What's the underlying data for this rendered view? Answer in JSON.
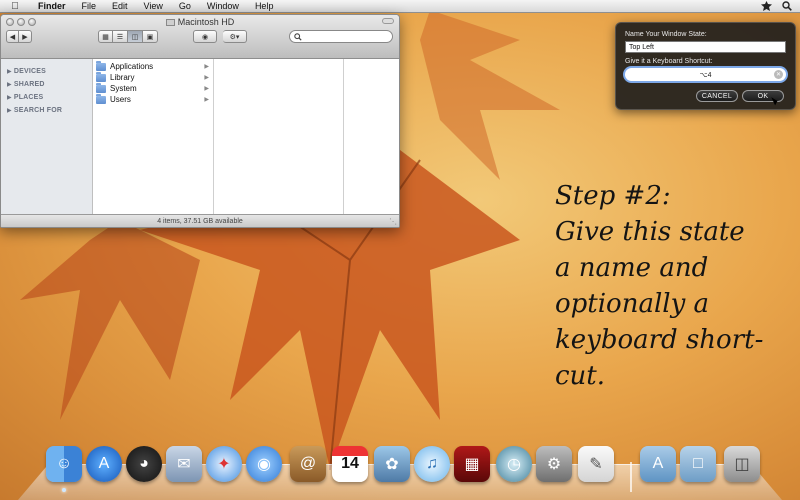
{
  "menubar": {
    "app_name": "Finder",
    "items": [
      "File",
      "Edit",
      "View",
      "Go",
      "Window",
      "Help"
    ]
  },
  "finder": {
    "title": "Macintosh HD",
    "search_placeholder": "",
    "sidebar_sections": [
      "DEVICES",
      "SHARED",
      "PLACES",
      "SEARCH FOR"
    ],
    "items": [
      "Applications",
      "Library",
      "System",
      "Users"
    ],
    "status": "4 items, 37.51 GB available"
  },
  "hud": {
    "name_label": "Name Your Window State:",
    "name_value": "Top Left",
    "shortcut_label": "Give it a Keyboard Shortcut:",
    "shortcut_value": "⌥4",
    "cancel_label": "CANCEL",
    "ok_label": "OK"
  },
  "annotation": {
    "lines": [
      "Step #2:",
      "Give this state",
      "a name and",
      "optionally a",
      "keyboard short-",
      "cut."
    ]
  },
  "dock": {
    "calendar_day": "14",
    "icons": [
      "finder-icon",
      "app-store-icon",
      "dashboard-icon",
      "mail-icon",
      "safari-icon",
      "ichat-icon",
      "address-book-icon",
      "ical-icon",
      "iphoto-icon",
      "itunes-icon",
      "front-row-icon",
      "time-machine-icon",
      "system-preferences-icon",
      "textedit-icon",
      "applications-stack-icon",
      "documents-stack-icon",
      "trash-icon"
    ]
  },
  "colors": {
    "hud_background": "#1c1c1c",
    "focus_ring": "#7da8e8",
    "desktop": "#e9a64c"
  }
}
